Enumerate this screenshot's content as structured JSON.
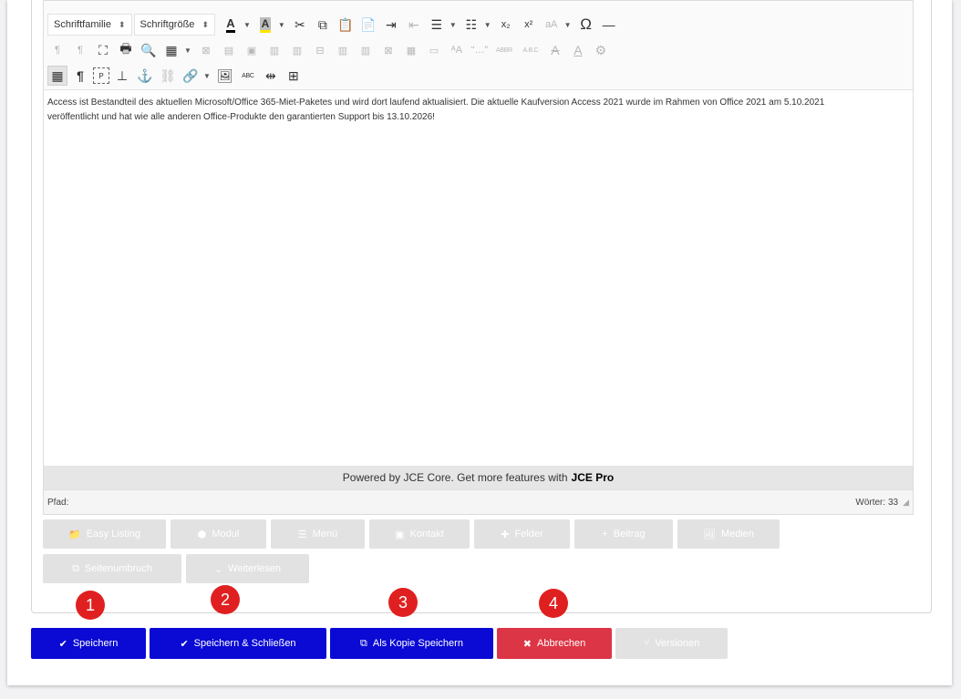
{
  "toolbar": {
    "font_family": "Schriftfamilie",
    "font_size": "Schriftgröße",
    "row1_icons": [
      "font-color",
      "bg-color",
      "cut",
      "copy",
      "paste",
      "paste-text",
      "indent",
      "outdent",
      "ordered-list",
      "unordered-list",
      "subscript",
      "superscript",
      "text-case",
      "special-char",
      "horizontal-rule"
    ],
    "row2_icons": [
      "ltr",
      "rtl",
      "fullscreen",
      "print",
      "search",
      "table",
      "delete-table",
      "row-props",
      "cell-props",
      "insert-row-before",
      "insert-row-after",
      "delete-row",
      "insert-col-before",
      "insert-col-after",
      "delete-col",
      "split-cells",
      "merge-cells",
      "style",
      "quote",
      "abbr",
      "acronym",
      "strikethrough",
      "underline",
      "settings"
    ],
    "row3_icons": [
      "visual-aid",
      "visual-chars",
      "blockquote",
      "anchor-insert",
      "anchor",
      "unlink",
      "link",
      "image",
      "spellcheck",
      "hr-page",
      "nonbreaking"
    ],
    "abbr_label": "ABBR",
    "abc_label": "A.B.C",
    "rbc_label": "ABC"
  },
  "content": {
    "line1": "Access ist Bestandteil des aktuellen Microsoft/Office 365-Miet-Paketes und wird dort laufend aktualisiert. Die aktuelle Kaufversion Access 2021 wurde im Rahmen von Office 2021 am 5.10.2021",
    "line2": "veröffentlicht und hat wie alle anderen Office-Produkte den garantierten Support bis 13.10.2026!"
  },
  "powered": {
    "prefix": "Powered by JCE Core. Get more features with",
    "brand": "JCE Pro"
  },
  "status": {
    "path_label": "Pfad:",
    "words_label": "Wörter: 33"
  },
  "xtd_buttons": [
    {
      "label": "Easy Listing",
      "icon": "folder-icon"
    },
    {
      "label": "Modul",
      "icon": "cube-icon"
    },
    {
      "label": "Menü",
      "icon": "list-icon"
    },
    {
      "label": "Kontakt",
      "icon": "contact-icon"
    },
    {
      "label": "Felder",
      "icon": "puzzle-icon"
    },
    {
      "label": "Beitrag",
      "icon": "plus-icon"
    },
    {
      "label": "Medien",
      "icon": "image-icon"
    },
    {
      "label": "Seitenumbruch",
      "icon": "copy-icon"
    },
    {
      "label": "Weiterlesen",
      "icon": "chevron-down-icon"
    }
  ],
  "badges": [
    "1",
    "2",
    "3",
    "4"
  ],
  "actions": {
    "save": "Speichern",
    "save_close": "Speichern & Schließen",
    "save_copy": "Als Kopie Speichern",
    "cancel": "Abbrechen",
    "versions": "Versionen"
  },
  "colors": {
    "primary": "#0a0ad4",
    "danger": "#dc3545",
    "badge": "#e02020",
    "disabled": "#e2e2e2"
  }
}
